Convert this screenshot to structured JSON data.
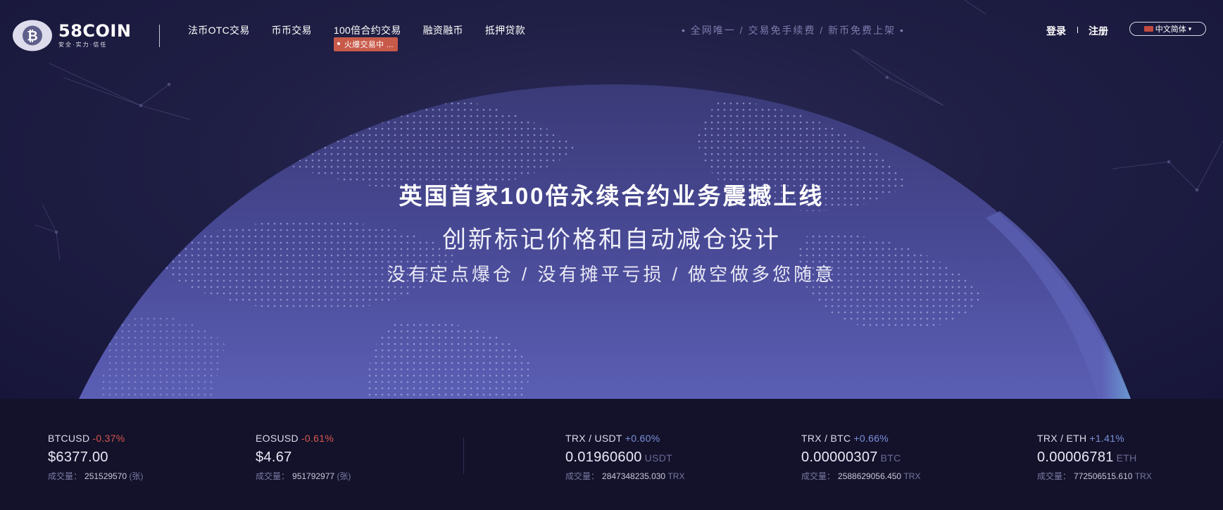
{
  "brand": {
    "name": "58COIN",
    "slogan": "安全·实力·信任",
    "logo_icon": "bitcoin-icon"
  },
  "nav": {
    "items": [
      {
        "label": "法币OTC交易"
      },
      {
        "label": "币币交易"
      },
      {
        "label": "100倍合约交易",
        "tag": "火爆交易中 ..."
      },
      {
        "label": "融资融币"
      },
      {
        "label": "抵押贷款"
      }
    ]
  },
  "promo": "• 全网唯一 / 交易免手续费 / 新币免费上架 •",
  "auth": {
    "login": "登录",
    "register": "注册"
  },
  "language": {
    "selected": "中文简体",
    "arrow": "▾"
  },
  "hero": {
    "title": "英国首家100倍永续合约业务震撼上线",
    "subtitle": "创新标记价格和自动减仓设计",
    "tagline": "没有定点爆仓 / 没有摊平亏损 / 做空做多您随意"
  },
  "colors": {
    "down": "#d9564f",
    "up": "#7b8fd9",
    "tag": "#c85a4a",
    "background": "#15142c"
  },
  "ticker": {
    "volume_label": "成交量：",
    "items": [
      {
        "pair": "BTCUSD",
        "change": "-0.37%",
        "direction": "down",
        "price": "$6377.00",
        "unit": "",
        "volume": "251529570",
        "volume_unit": "(张)"
      },
      {
        "pair": "EOSUSD",
        "change": "-0.61%",
        "direction": "down",
        "price": "$4.67",
        "unit": "",
        "volume": "951792977",
        "volume_unit": "(张)"
      },
      {
        "pair": "TRX / USDT",
        "change": "+0.60%",
        "direction": "up",
        "price": "0.01960600",
        "unit": "USDT",
        "volume": "2847348235.030",
        "volume_unit": "TRX"
      },
      {
        "pair": "TRX / BTC",
        "change": "+0.66%",
        "direction": "up",
        "price": "0.00000307",
        "unit": "BTC",
        "volume": "2588629056.450",
        "volume_unit": "TRX"
      },
      {
        "pair": "TRX / ETH",
        "change": "+1.41%",
        "direction": "up",
        "price": "0.00006781",
        "unit": "ETH",
        "volume": "772506515.610",
        "volume_unit": "TRX"
      }
    ]
  }
}
